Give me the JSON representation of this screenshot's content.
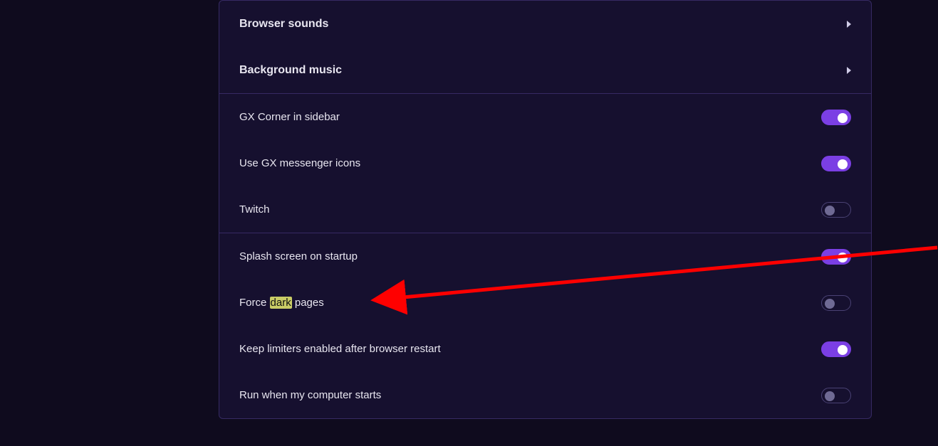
{
  "expanders": {
    "browser_sounds": "Browser sounds",
    "background_music": "Background music"
  },
  "settings_group1": [
    {
      "key": "gx_corner",
      "label": "GX Corner in sidebar",
      "on": true
    },
    {
      "key": "gx_msg",
      "label": "Use GX messenger icons",
      "on": true
    },
    {
      "key": "twitch",
      "label": "Twitch",
      "on": false
    }
  ],
  "settings_group2": [
    {
      "key": "splash",
      "label": "Splash screen on startup",
      "on": true
    },
    {
      "key": "force_dark",
      "label_pre": "Force ",
      "label_hl": "dark",
      "label_post": " pages",
      "on": false
    },
    {
      "key": "limiters",
      "label": "Keep limiters enabled after browser restart",
      "on": true
    },
    {
      "key": "run_start",
      "label": "Run when my computer starts",
      "on": false
    }
  ],
  "colors": {
    "accent": "#7b3fe4",
    "highlight": "#c9cc66",
    "arrow": "#ff0000"
  }
}
